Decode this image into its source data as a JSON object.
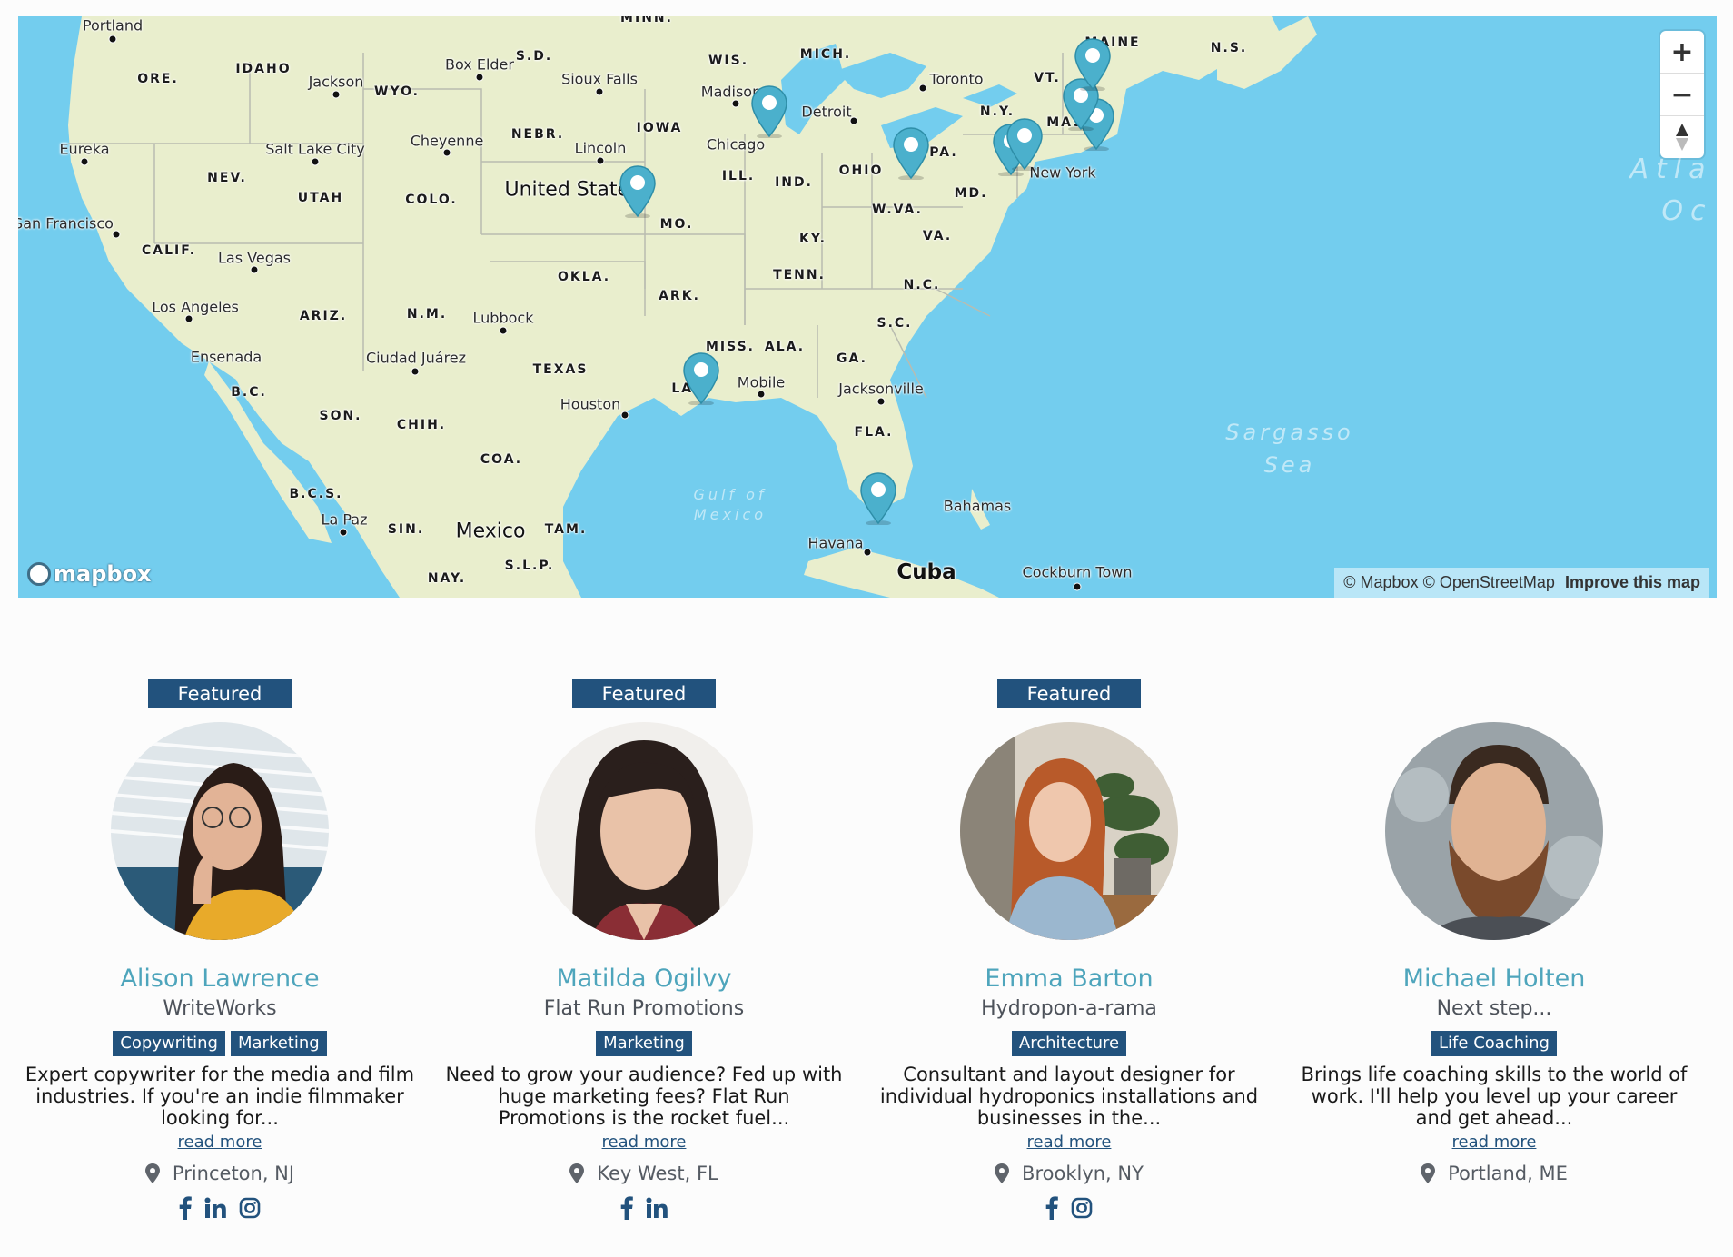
{
  "map": {
    "attribution": {
      "mapbox": "© Mapbox",
      "osm": "© OpenStreetMap",
      "improve": "Improve this map"
    },
    "logo": "mapbox",
    "controls": {
      "zoom_in": "+",
      "zoom_out": "−",
      "compass": "compass-icon"
    },
    "colors": {
      "water": "#73cdee",
      "land": "#e9eecd",
      "pin": "#4bb0cc"
    },
    "labels": {
      "cities": [
        "Portland",
        "Jackson",
        "Box Elder",
        "Sioux Falls",
        "Madison",
        "Toronto",
        "Detroit",
        "Eureka",
        "Salt Lake City",
        "Cheyenne",
        "Lincoln",
        "Chicago",
        "New York",
        "San Francisco",
        "Las Vegas",
        "Los Angeles",
        "Lubbock",
        "Ensenada",
        "Ciudad Juárez",
        "Mobile",
        "Jacksonville",
        "Houston",
        "Havana",
        "Bahamas",
        "La Paz",
        "Cockburn Town"
      ],
      "states": [
        "MINN.",
        "S.D.",
        "WIS.",
        "MICH.",
        "MAINE",
        "N.S.",
        "ORE.",
        "IDAHO",
        "WYO.",
        "VT.",
        "N.Y.",
        "MASS.",
        "NEBR.",
        "IOWA",
        "NEV.",
        "PA.",
        "UTAH",
        "COLO.",
        "ILL.",
        "IND.",
        "OHIO",
        "MD.",
        "MO.",
        "W.VA.",
        "CALIF.",
        "KY.",
        "VA.",
        "OKLA.",
        "TENN.",
        "N.C.",
        "ARIZ.",
        "N.M.",
        "ARK.",
        "S.C.",
        "TEXAS",
        "MISS.",
        "ALA.",
        "GA.",
        "LA.",
        "B.C.",
        "SON.",
        "CHIH.",
        "FLA.",
        "COA.",
        "B.C.S.",
        "SIN.",
        "TAM.",
        "S.L.P.",
        "NAY."
      ],
      "countries": [
        "United States",
        "Mexico",
        "Cuba"
      ],
      "seas": [
        "Gulf of Mexico",
        "Sargasso Sea",
        "Atlantic Ocean"
      ]
    },
    "pin_count": 10
  },
  "members": [
    {
      "featured": true,
      "featured_label": "Featured",
      "name": "Alison Lawrence",
      "company": "WriteWorks",
      "tags": [
        "Copywriting",
        "Marketing"
      ],
      "description": "Expert copywriter for the media and film industries. If you're an indie filmmaker looking for...",
      "read_more": "read more",
      "location": "Princeton, NJ",
      "social": [
        "facebook",
        "linkedin",
        "instagram"
      ]
    },
    {
      "featured": true,
      "featured_label": "Featured",
      "name": "Matilda Ogilvy",
      "company": "Flat Run Promotions",
      "tags": [
        "Marketing"
      ],
      "description": "Need to grow your audience? Fed up with huge marketing fees? Flat Run Promotions is the rocket fuel...",
      "read_more": "read more",
      "location": "Key West, FL",
      "social": [
        "facebook",
        "linkedin"
      ]
    },
    {
      "featured": true,
      "featured_label": "Featured",
      "name": "Emma Barton",
      "company": "Hydropon-a-rama",
      "tags": [
        "Architecture"
      ],
      "description": "Consultant and layout designer for individual hydroponics installations and businesses in the...",
      "read_more": "read more",
      "location": "Brooklyn, NY",
      "social": [
        "facebook",
        "instagram"
      ]
    },
    {
      "featured": false,
      "featured_label": "",
      "name": "Michael Holten",
      "company": "Next step...",
      "tags": [
        "Life Coaching"
      ],
      "description": "Brings life coaching skills to the world of work. I'll help you level up your career and get ahead...",
      "read_more": "read more",
      "location": "Portland, ME",
      "social": []
    }
  ],
  "colors": {
    "accent": "#22527d",
    "name": "#4ea5bc"
  }
}
